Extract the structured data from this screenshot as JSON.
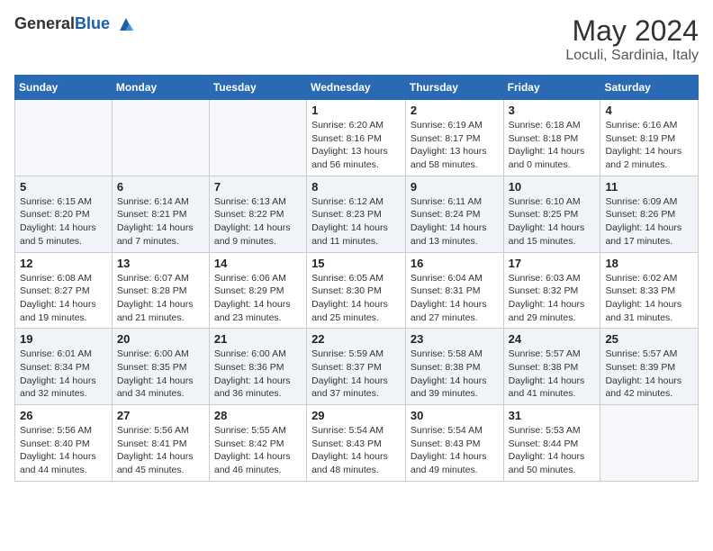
{
  "header": {
    "logo_general": "General",
    "logo_blue": "Blue",
    "month_title": "May 2024",
    "location": "Loculi, Sardinia, Italy"
  },
  "weekdays": [
    "Sunday",
    "Monday",
    "Tuesday",
    "Wednesday",
    "Thursday",
    "Friday",
    "Saturday"
  ],
  "weeks": [
    [
      {
        "day": "",
        "info": ""
      },
      {
        "day": "",
        "info": ""
      },
      {
        "day": "",
        "info": ""
      },
      {
        "day": "1",
        "info": "Sunrise: 6:20 AM\nSunset: 8:16 PM\nDaylight: 13 hours\nand 56 minutes."
      },
      {
        "day": "2",
        "info": "Sunrise: 6:19 AM\nSunset: 8:17 PM\nDaylight: 13 hours\nand 58 minutes."
      },
      {
        "day": "3",
        "info": "Sunrise: 6:18 AM\nSunset: 8:18 PM\nDaylight: 14 hours\nand 0 minutes."
      },
      {
        "day": "4",
        "info": "Sunrise: 6:16 AM\nSunset: 8:19 PM\nDaylight: 14 hours\nand 2 minutes."
      }
    ],
    [
      {
        "day": "5",
        "info": "Sunrise: 6:15 AM\nSunset: 8:20 PM\nDaylight: 14 hours\nand 5 minutes."
      },
      {
        "day": "6",
        "info": "Sunrise: 6:14 AM\nSunset: 8:21 PM\nDaylight: 14 hours\nand 7 minutes."
      },
      {
        "day": "7",
        "info": "Sunrise: 6:13 AM\nSunset: 8:22 PM\nDaylight: 14 hours\nand 9 minutes."
      },
      {
        "day": "8",
        "info": "Sunrise: 6:12 AM\nSunset: 8:23 PM\nDaylight: 14 hours\nand 11 minutes."
      },
      {
        "day": "9",
        "info": "Sunrise: 6:11 AM\nSunset: 8:24 PM\nDaylight: 14 hours\nand 13 minutes."
      },
      {
        "day": "10",
        "info": "Sunrise: 6:10 AM\nSunset: 8:25 PM\nDaylight: 14 hours\nand 15 minutes."
      },
      {
        "day": "11",
        "info": "Sunrise: 6:09 AM\nSunset: 8:26 PM\nDaylight: 14 hours\nand 17 minutes."
      }
    ],
    [
      {
        "day": "12",
        "info": "Sunrise: 6:08 AM\nSunset: 8:27 PM\nDaylight: 14 hours\nand 19 minutes."
      },
      {
        "day": "13",
        "info": "Sunrise: 6:07 AM\nSunset: 8:28 PM\nDaylight: 14 hours\nand 21 minutes."
      },
      {
        "day": "14",
        "info": "Sunrise: 6:06 AM\nSunset: 8:29 PM\nDaylight: 14 hours\nand 23 minutes."
      },
      {
        "day": "15",
        "info": "Sunrise: 6:05 AM\nSunset: 8:30 PM\nDaylight: 14 hours\nand 25 minutes."
      },
      {
        "day": "16",
        "info": "Sunrise: 6:04 AM\nSunset: 8:31 PM\nDaylight: 14 hours\nand 27 minutes."
      },
      {
        "day": "17",
        "info": "Sunrise: 6:03 AM\nSunset: 8:32 PM\nDaylight: 14 hours\nand 29 minutes."
      },
      {
        "day": "18",
        "info": "Sunrise: 6:02 AM\nSunset: 8:33 PM\nDaylight: 14 hours\nand 31 minutes."
      }
    ],
    [
      {
        "day": "19",
        "info": "Sunrise: 6:01 AM\nSunset: 8:34 PM\nDaylight: 14 hours\nand 32 minutes."
      },
      {
        "day": "20",
        "info": "Sunrise: 6:00 AM\nSunset: 8:35 PM\nDaylight: 14 hours\nand 34 minutes."
      },
      {
        "day": "21",
        "info": "Sunrise: 6:00 AM\nSunset: 8:36 PM\nDaylight: 14 hours\nand 36 minutes."
      },
      {
        "day": "22",
        "info": "Sunrise: 5:59 AM\nSunset: 8:37 PM\nDaylight: 14 hours\nand 37 minutes."
      },
      {
        "day": "23",
        "info": "Sunrise: 5:58 AM\nSunset: 8:38 PM\nDaylight: 14 hours\nand 39 minutes."
      },
      {
        "day": "24",
        "info": "Sunrise: 5:57 AM\nSunset: 8:38 PM\nDaylight: 14 hours\nand 41 minutes."
      },
      {
        "day": "25",
        "info": "Sunrise: 5:57 AM\nSunset: 8:39 PM\nDaylight: 14 hours\nand 42 minutes."
      }
    ],
    [
      {
        "day": "26",
        "info": "Sunrise: 5:56 AM\nSunset: 8:40 PM\nDaylight: 14 hours\nand 44 minutes."
      },
      {
        "day": "27",
        "info": "Sunrise: 5:56 AM\nSunset: 8:41 PM\nDaylight: 14 hours\nand 45 minutes."
      },
      {
        "day": "28",
        "info": "Sunrise: 5:55 AM\nSunset: 8:42 PM\nDaylight: 14 hours\nand 46 minutes."
      },
      {
        "day": "29",
        "info": "Sunrise: 5:54 AM\nSunset: 8:43 PM\nDaylight: 14 hours\nand 48 minutes."
      },
      {
        "day": "30",
        "info": "Sunrise: 5:54 AM\nSunset: 8:43 PM\nDaylight: 14 hours\nand 49 minutes."
      },
      {
        "day": "31",
        "info": "Sunrise: 5:53 AM\nSunset: 8:44 PM\nDaylight: 14 hours\nand 50 minutes."
      },
      {
        "day": "",
        "info": ""
      }
    ]
  ]
}
